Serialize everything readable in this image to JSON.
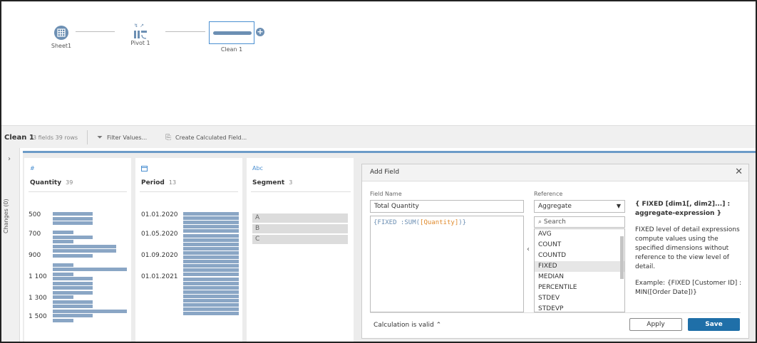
{
  "flow": {
    "nodes": [
      {
        "label": "Sheet1"
      },
      {
        "label": "Pivot 1"
      },
      {
        "label": "Clean 1"
      }
    ]
  },
  "toolbar": {
    "title": "Clean 1",
    "meta": "3 fields  39 rows",
    "filter_label": "Filter Values...",
    "calc_label": "Create Calculated Field..."
  },
  "side": {
    "changes_label": "Changes (0)"
  },
  "profile": {
    "quantity": {
      "type_icon": "#",
      "name": "Quantity",
      "count": "39",
      "axis_labels": [
        "500",
        "700",
        "900",
        "1 100",
        "1 300",
        "1 500"
      ],
      "bin_levels": [
        0.54,
        0.54,
        0.54,
        0,
        0.28,
        0.54,
        0.28,
        0.86,
        0.86,
        0.54,
        0,
        0.28,
        1.0,
        0.28,
        0.54,
        0.54,
        0.54,
        0.54,
        0.28,
        0.54,
        0.54,
        1.0,
        0.54,
        0.28
      ]
    },
    "period": {
      "type_icon": "📅",
      "name": "Period",
      "count": "13",
      "axis_labels": [
        "01.01.2020",
        "01.05.2020",
        "01.09.2020",
        "01.01.2021"
      ],
      "bar_count": 24
    },
    "segment": {
      "type_icon": "Abc",
      "name": "Segment",
      "count": "3",
      "items": [
        "A",
        "B",
        "C"
      ]
    }
  },
  "dialog": {
    "title": "Add Field",
    "field_name_label": "Field Name",
    "field_name_value": "Total Quantity",
    "calc_open": "{FIXED :",
    "calc_fn": "SUM(",
    "calc_field": "[Quantity]",
    "calc_close": ")}",
    "reference_label": "Reference",
    "reference_selected": "Aggregate",
    "search_placeholder": "Search",
    "functions": [
      "AVG",
      "COUNT",
      "COUNTD",
      "FIXED",
      "MEDIAN",
      "PERCENTILE",
      "STDEV",
      "STDEVP"
    ],
    "active_function": "FIXED",
    "help_signature": "{ FIXED [dim1[, dim2]...] : aggregate-expression }",
    "help_desc": "FIXED level of detail expressions compute values using the specified dimensions without reference to the view level of detail.",
    "help_example": "Example: {FIXED [Customer ID] : MIN([Order Date])}",
    "status": "Calculation is valid",
    "apply_label": "Apply",
    "save_label": "Save"
  }
}
